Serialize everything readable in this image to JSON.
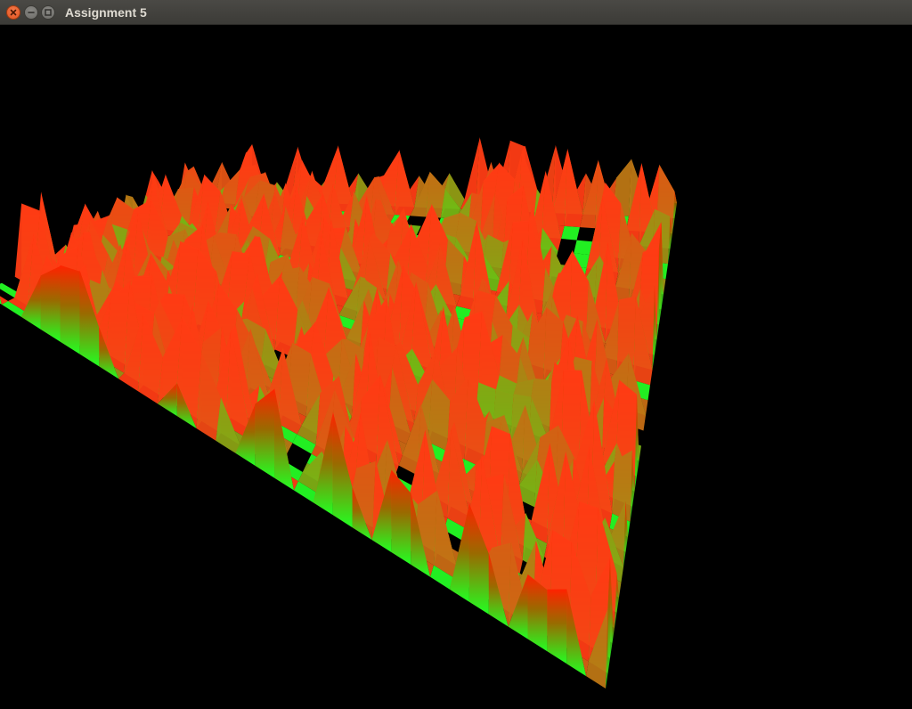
{
  "window": {
    "title": "Assignment 5",
    "buttons": {
      "close_icon": "close-icon",
      "minimize_icon": "minimize-icon",
      "maximize_icon": "maximize-icon"
    }
  },
  "scene": {
    "description_type": "3d-terrain-heightmap",
    "background_color": "#000000",
    "low_color": "#22ff22",
    "high_color": "#ff2200"
  }
}
